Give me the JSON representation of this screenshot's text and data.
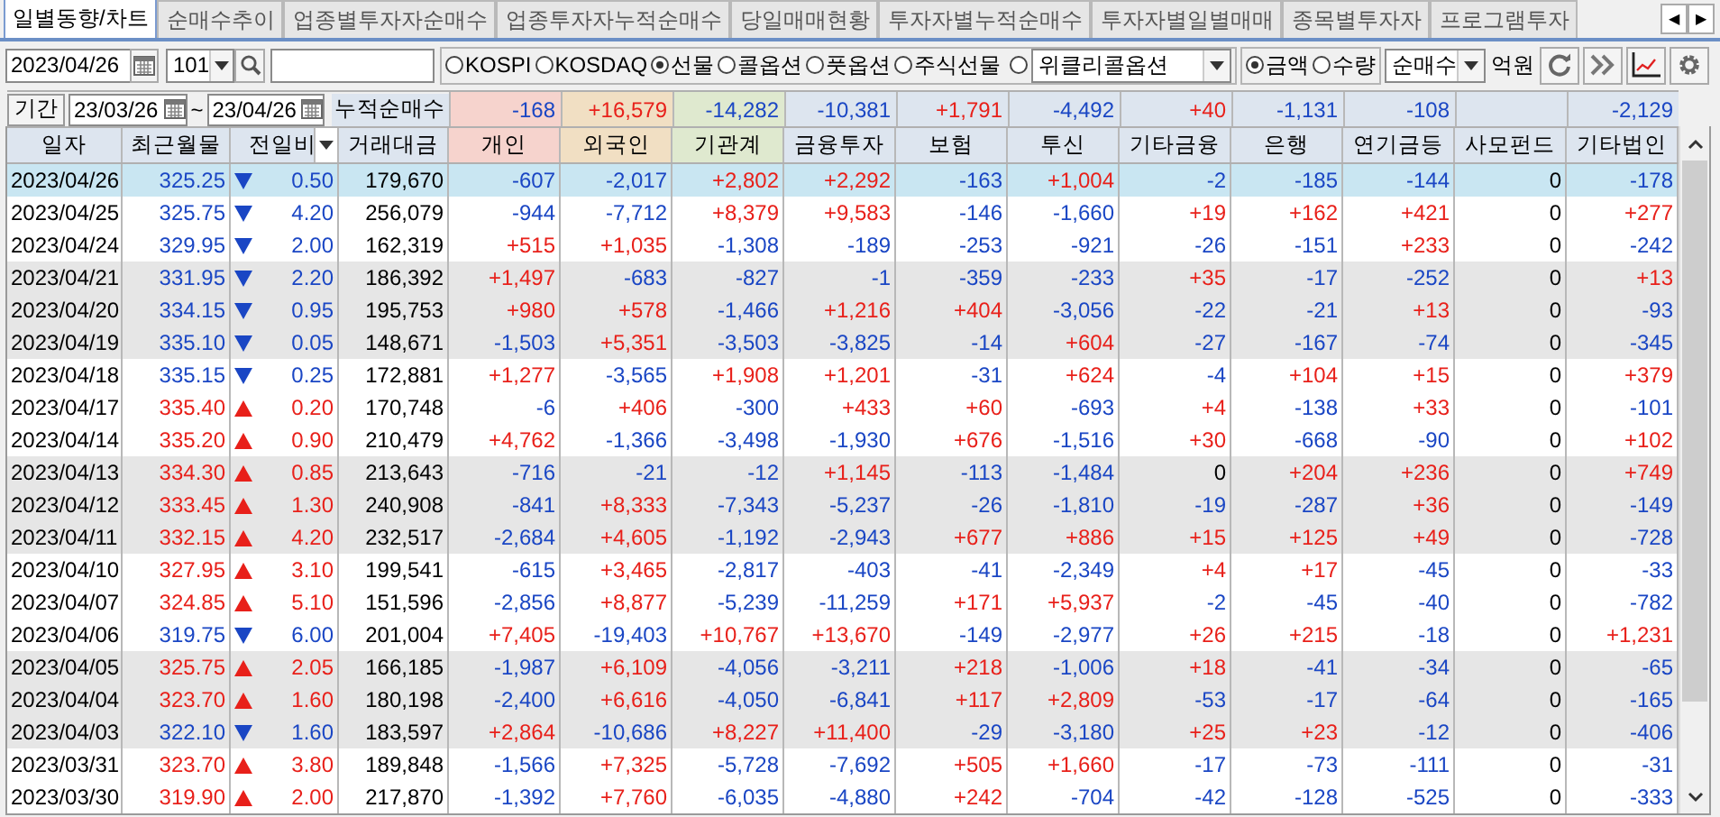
{
  "tabs": [
    {
      "label": "일별동향/차트",
      "selected": true
    },
    {
      "label": "순매수추이",
      "selected": false
    },
    {
      "label": "업종별투자자순매수",
      "selected": false
    },
    {
      "label": "업종투자자누적순매수",
      "selected": false
    },
    {
      "label": "당일매매현황",
      "selected": false
    },
    {
      "label": "투자자별누적순매수",
      "selected": false
    },
    {
      "label": "투자자별일별매매",
      "selected": false
    },
    {
      "label": "종목별투자자",
      "selected": false
    },
    {
      "label": "프로그램투자",
      "selected": false
    }
  ],
  "tab_scroll": [
    "◀",
    "▶"
  ],
  "toolbar": {
    "date": "2023/04/26",
    "code": "101",
    "markets": [
      {
        "label": "KOSPI",
        "selected": false
      },
      {
        "label": "KOSDAQ",
        "selected": false
      },
      {
        "label": "선물",
        "selected": true
      },
      {
        "label": "콜옵션",
        "selected": false
      },
      {
        "label": "풋옵션",
        "selected": false
      },
      {
        "label": "주식선물",
        "selected": false
      }
    ],
    "weekly_option": {
      "selected": false,
      "value": "위클리콜옵션"
    },
    "units": [
      {
        "label": "금액",
        "selected": true
      },
      {
        "label": "수량",
        "selected": false
      }
    ],
    "mode": "순매수",
    "unit_label": "억원"
  },
  "period": {
    "button": "기간",
    "from": "23/03/26",
    "separator": "~",
    "to": "23/04/26",
    "label": "누적순매수"
  },
  "columns": [
    {
      "label": "일자",
      "color": "#dde5ef"
    },
    {
      "label": "최근월물",
      "color": "#dde5ef"
    },
    {
      "label": "전일비",
      "color": "#dde5ef"
    },
    {
      "label": "거래대금",
      "color": "#dde5ef"
    },
    {
      "label": "개인",
      "color": "#f6d3cd"
    },
    {
      "label": "외국인",
      "color": "#f1dfc3"
    },
    {
      "label": "기관계",
      "color": "#dfe9cf"
    },
    {
      "label": "금융투자",
      "color": "#dde5ef"
    },
    {
      "label": "보험",
      "color": "#dde5ef"
    },
    {
      "label": "투신",
      "color": "#dde5ef"
    },
    {
      "label": "기타금융",
      "color": "#dde5ef"
    },
    {
      "label": "은행",
      "color": "#dde5ef"
    },
    {
      "label": "연기금등",
      "color": "#dde5ef"
    },
    {
      "label": "사모펀드",
      "color": "#dde5ef"
    },
    {
      "label": "기타법인",
      "color": "#dde5ef"
    }
  ],
  "totals": [
    {
      "kind": "value",
      "value": "-168"
    },
    {
      "kind": "value",
      "value": "+16,579"
    },
    {
      "kind": "value",
      "value": "-14,282"
    },
    {
      "kind": "value",
      "value": "-10,381"
    },
    {
      "kind": "value",
      "value": "+1,791"
    },
    {
      "kind": "value",
      "value": "-4,492"
    },
    {
      "kind": "value",
      "value": "+40"
    },
    {
      "kind": "value",
      "value": "-1,131"
    },
    {
      "kind": "value",
      "value": "-108"
    },
    {
      "kind": "blank"
    },
    {
      "kind": "value",
      "value": "-2,129"
    }
  ],
  "rows": [
    {
      "date": "2023/04/26",
      "price": "325.25",
      "up": false,
      "change": "0.50",
      "volume": "179,670",
      "selected": true,
      "values": [
        "-607",
        "-2,017",
        "+2,802",
        "+2,292",
        "-163",
        "+1,004",
        "-2",
        "-185",
        "-144",
        "0",
        "-178"
      ]
    },
    {
      "date": "2023/04/25",
      "price": "325.75",
      "up": false,
      "change": "4.20",
      "volume": "256,079",
      "selected": false,
      "values": [
        "-944",
        "-7,712",
        "+8,379",
        "+9,583",
        "-146",
        "-1,660",
        "+19",
        "+162",
        "+421",
        "0",
        "+277"
      ]
    },
    {
      "date": "2023/04/24",
      "price": "329.95",
      "up": false,
      "change": "2.00",
      "volume": "162,319",
      "selected": false,
      "values": [
        "+515",
        "+1,035",
        "-1,308",
        "-189",
        "-253",
        "-921",
        "-26",
        "-151",
        "+233",
        "0",
        "-242"
      ]
    },
    {
      "date": "2023/04/21",
      "price": "331.95",
      "up": false,
      "change": "2.20",
      "volume": "186,392",
      "selected": false,
      "values": [
        "+1,497",
        "-683",
        "-827",
        "-1",
        "-359",
        "-233",
        "+35",
        "-17",
        "-252",
        "0",
        "+13"
      ]
    },
    {
      "date": "2023/04/20",
      "price": "334.15",
      "up": false,
      "change": "0.95",
      "volume": "195,753",
      "selected": false,
      "values": [
        "+980",
        "+578",
        "-1,466",
        "+1,216",
        "+404",
        "-3,056",
        "-22",
        "-21",
        "+13",
        "0",
        "-93"
      ]
    },
    {
      "date": "2023/04/19",
      "price": "335.10",
      "up": false,
      "change": "0.05",
      "volume": "148,671",
      "selected": false,
      "values": [
        "-1,503",
        "+5,351",
        "-3,503",
        "-3,825",
        "-14",
        "+604",
        "-27",
        "-167",
        "-74",
        "0",
        "-345"
      ]
    },
    {
      "date": "2023/04/18",
      "price": "335.15",
      "up": false,
      "change": "0.25",
      "volume": "172,881",
      "selected": false,
      "values": [
        "+1,277",
        "-3,565",
        "+1,908",
        "+1,201",
        "-31",
        "+624",
        "-4",
        "+104",
        "+15",
        "0",
        "+379"
      ]
    },
    {
      "date": "2023/04/17",
      "price": "335.40",
      "up": true,
      "change": "0.20",
      "volume": "170,748",
      "selected": false,
      "values": [
        "-6",
        "+406",
        "-300",
        "+433",
        "+60",
        "-693",
        "+4",
        "-138",
        "+33",
        "0",
        "-101"
      ]
    },
    {
      "date": "2023/04/14",
      "price": "335.20",
      "up": true,
      "change": "0.90",
      "volume": "210,479",
      "selected": false,
      "values": [
        "+4,762",
        "-1,366",
        "-3,498",
        "-1,930",
        "+676",
        "-1,516",
        "+30",
        "-668",
        "-90",
        "0",
        "+102"
      ]
    },
    {
      "date": "2023/04/13",
      "price": "334.30",
      "up": true,
      "change": "0.85",
      "volume": "213,643",
      "selected": false,
      "values": [
        "-716",
        "-21",
        "-12",
        "+1,145",
        "-113",
        "-1,484",
        "0",
        "+204",
        "+236",
        "0",
        "+749"
      ]
    },
    {
      "date": "2023/04/12",
      "price": "333.45",
      "up": true,
      "change": "1.30",
      "volume": "240,908",
      "selected": false,
      "values": [
        "-841",
        "+8,333",
        "-7,343",
        "-5,237",
        "-26",
        "-1,810",
        "-19",
        "-287",
        "+36",
        "0",
        "-149"
      ]
    },
    {
      "date": "2023/04/11",
      "price": "332.15",
      "up": true,
      "change": "4.20",
      "volume": "232,517",
      "selected": false,
      "values": [
        "-2,684",
        "+4,605",
        "-1,192",
        "-2,943",
        "+677",
        "+886",
        "+15",
        "+125",
        "+49",
        "0",
        "-728"
      ]
    },
    {
      "date": "2023/04/10",
      "price": "327.95",
      "up": true,
      "change": "3.10",
      "volume": "199,541",
      "selected": false,
      "values": [
        "-615",
        "+3,465",
        "-2,817",
        "-403",
        "-41",
        "-2,349",
        "+4",
        "+17",
        "-45",
        "0",
        "-33"
      ]
    },
    {
      "date": "2023/04/07",
      "price": "324.85",
      "up": true,
      "change": "5.10",
      "volume": "151,596",
      "selected": false,
      "values": [
        "-2,856",
        "+8,877",
        "-5,239",
        "-11,259",
        "+171",
        "+5,937",
        "-2",
        "-45",
        "-40",
        "0",
        "-782"
      ]
    },
    {
      "date": "2023/04/06",
      "price": "319.75",
      "up": false,
      "change": "6.00",
      "volume": "201,004",
      "selected": false,
      "values": [
        "+7,405",
        "-19,403",
        "+10,767",
        "+13,670",
        "-149",
        "-2,977",
        "+26",
        "+215",
        "-18",
        "0",
        "+1,231"
      ]
    },
    {
      "date": "2023/04/05",
      "price": "325.75",
      "up": true,
      "change": "2.05",
      "volume": "166,185",
      "selected": false,
      "values": [
        "-1,987",
        "+6,109",
        "-4,056",
        "-3,211",
        "+218",
        "-1,006",
        "+18",
        "-41",
        "-34",
        "0",
        "-65"
      ]
    },
    {
      "date": "2023/04/04",
      "price": "323.70",
      "up": true,
      "change": "1.60",
      "volume": "180,198",
      "selected": false,
      "values": [
        "-2,400",
        "+6,616",
        "-4,050",
        "-6,841",
        "+117",
        "+2,809",
        "-53",
        "-17",
        "-64",
        "0",
        "-165"
      ]
    },
    {
      "date": "2023/04/03",
      "price": "322.10",
      "up": false,
      "change": "1.60",
      "volume": "183,597",
      "selected": false,
      "values": [
        "+2,864",
        "-10,686",
        "+8,227",
        "+11,400",
        "-29",
        "-3,180",
        "+25",
        "+23",
        "-12",
        "0",
        "-406"
      ]
    },
    {
      "date": "2023/03/31",
      "price": "323.70",
      "up": true,
      "change": "3.80",
      "volume": "189,848",
      "selected": false,
      "values": [
        "-1,566",
        "+7,325",
        "-5,728",
        "-7,692",
        "+505",
        "+1,660",
        "-17",
        "-73",
        "-111",
        "0",
        "-31"
      ]
    },
    {
      "date": "2023/03/30",
      "price": "319.90",
      "up": true,
      "change": "2.00",
      "volume": "217,870",
      "selected": false,
      "values": [
        "-1,392",
        "+7,760",
        "-6,035",
        "-4,880",
        "+242",
        "-704",
        "-42",
        "-128",
        "-525",
        "0",
        "-333"
      ]
    }
  ]
}
